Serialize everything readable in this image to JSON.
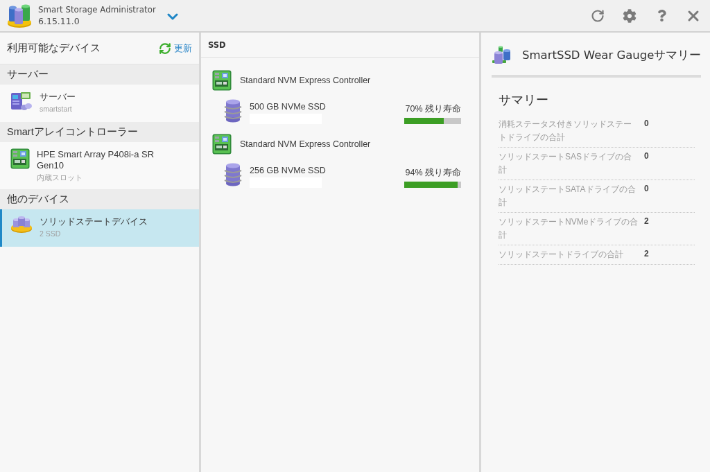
{
  "app": {
    "title": "Smart Storage Administrator",
    "version": "6.15.11.0"
  },
  "devices_panel": {
    "title": "利用可能なデバイス",
    "refresh_label": "更新",
    "groups": [
      {
        "heading": "サーバー",
        "items": [
          {
            "kind": "server",
            "name": "サーバー",
            "detail": "smartstart",
            "selected": false
          }
        ]
      },
      {
        "heading": "Smartアレイコントローラー",
        "items": [
          {
            "kind": "controller",
            "name": "HPE Smart Array P408i-a SR Gen10",
            "detail": "内蔵スロット",
            "selected": false
          }
        ]
      },
      {
        "heading": "他のデバイス",
        "items": [
          {
            "kind": "ssd",
            "name": "ソリッドステートデバイス",
            "detail": "2 SSD",
            "selected": true
          }
        ]
      }
    ]
  },
  "ssd_panel": {
    "title": "SSD",
    "controllers": [
      {
        "name": "Standard NVM Express Controller",
        "drives": [
          {
            "name": "500 GB NVMe SSD",
            "reading": "70% 残り寿命",
            "level": 0.7
          }
        ]
      },
      {
        "name": "Standard NVM Express Controller",
        "drives": [
          {
            "name": "256 GB NVMe SSD",
            "reading": "94% 残り寿命",
            "level": 0.94
          }
        ]
      }
    ]
  },
  "summary_panel": {
    "title": "SmartSSD Wear Gaugeサマリー",
    "heading": "サマリー",
    "rows": [
      {
        "label": "消耗ステータス付きソリッドステートドライブの合計",
        "value": "0"
      },
      {
        "label": "ソリッドステートSASドライブの合計",
        "value": "0"
      },
      {
        "label": "ソリッドステートSATAドライブの合計",
        "value": "0"
      },
      {
        "label": "ソリッドステートNVMeドライブの合計",
        "value": "2"
      },
      {
        "label": "ソリッドステートドライブの合計",
        "value": "2"
      }
    ]
  }
}
